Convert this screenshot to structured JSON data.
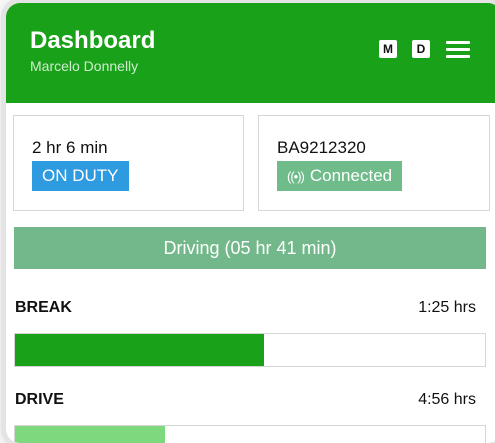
{
  "header": {
    "title": "Dashboard",
    "subtitle": "Marcelo Donnelly",
    "badge_m": "M",
    "badge_d": "D",
    "menu_icon": "hamburger-menu-icon"
  },
  "cards": {
    "duty_time": "2 hr 6 min",
    "duty_status": "ON DUTY",
    "vehicle_id": "BA9212320",
    "connection_icon": "wireless-signal-icon",
    "connection_status": "Connected"
  },
  "driving": {
    "label": "Driving (05 hr 41 min)"
  },
  "timers": [
    {
      "label": "BREAK",
      "value": "1:25 hrs",
      "fill_fraction": 0.53,
      "fill_color": "#1aa11a"
    },
    {
      "label": "DRIVE",
      "value": "4:56 hrs",
      "fill_fraction": 0.32,
      "fill_color": "#7ed87e"
    }
  ],
  "colors": {
    "brand_green": "#1aa11a",
    "on_duty_blue": "#2e9ae0",
    "connected_green": "#6fbb8a",
    "driving_green": "#72b88a"
  }
}
